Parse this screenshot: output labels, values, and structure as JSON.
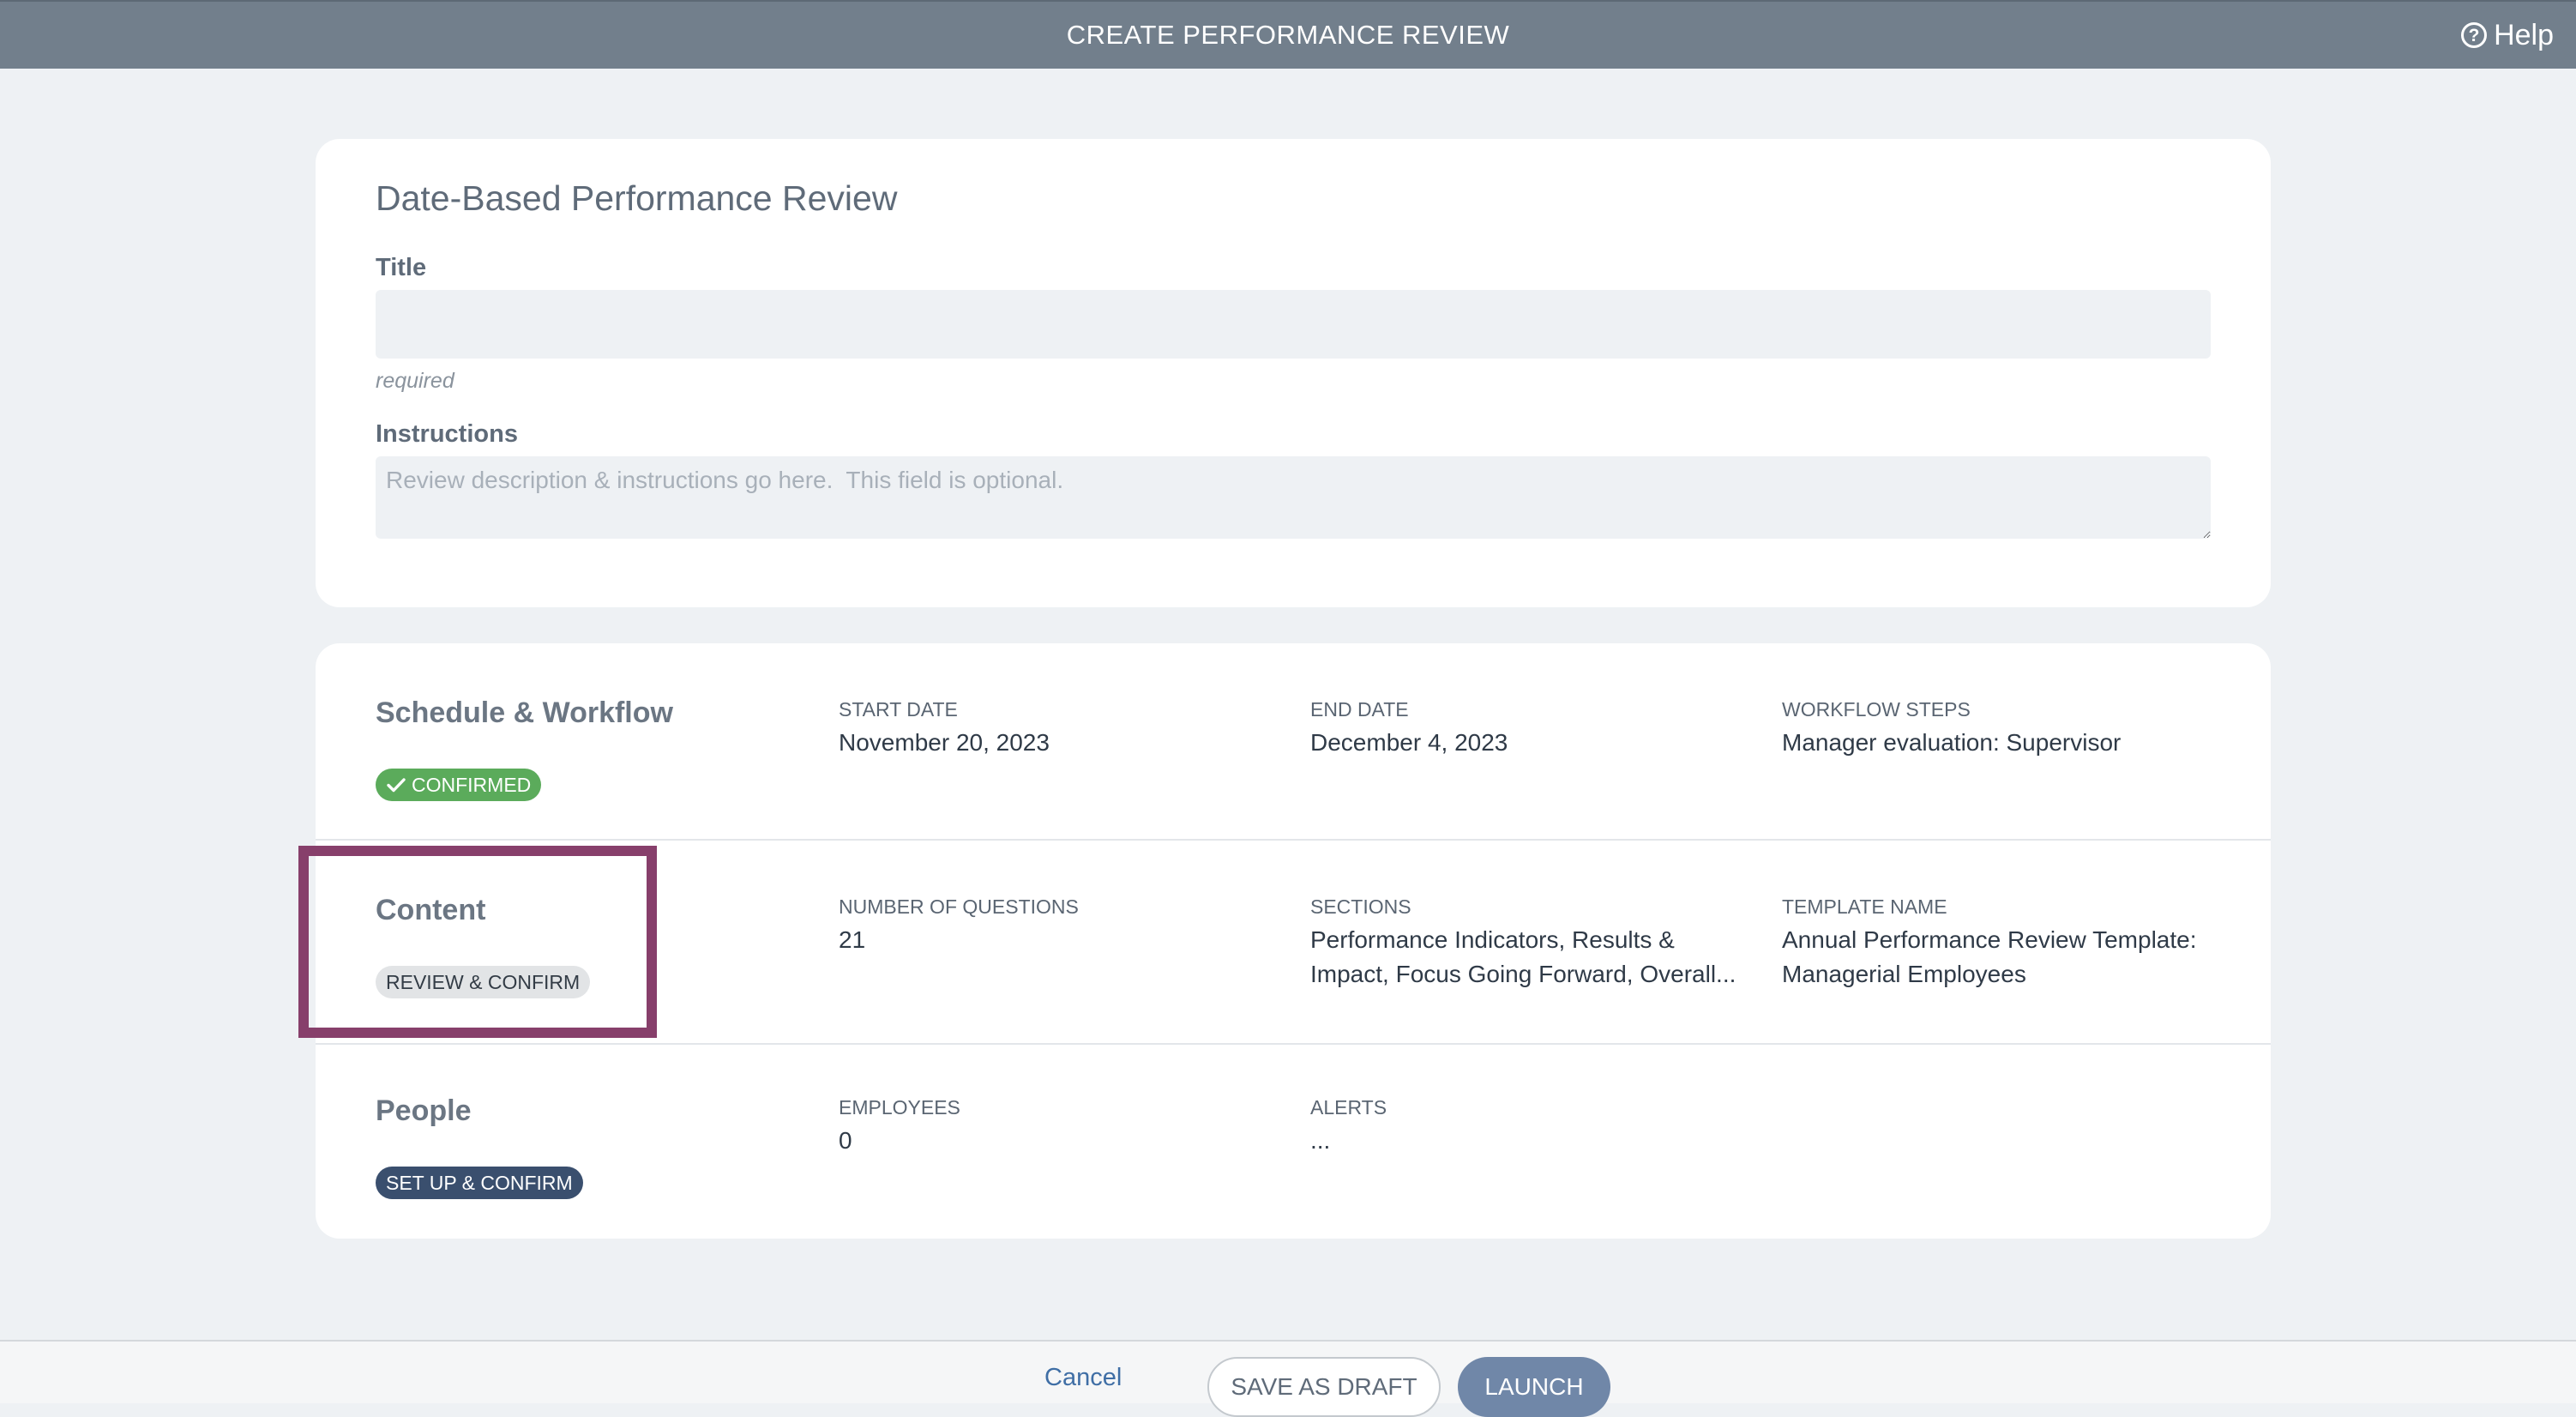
{
  "header": {
    "title": "CREATE PERFORMANCE REVIEW",
    "help_label": "Help",
    "help_icon": "question-circle-icon"
  },
  "form": {
    "heading": "Date-Based Performance Review",
    "title_label": "Title",
    "title_value": "",
    "title_hint": "required",
    "instructions_label": "Instructions",
    "instructions_placeholder": "Review description & instructions go here.  This field is optional.",
    "instructions_value": ""
  },
  "sections": {
    "schedule": {
      "title": "Schedule & Workflow",
      "status": "CONFIRMED",
      "status_icon": "checkmark-icon",
      "status_color": "#5bab5b",
      "fields": [
        {
          "label": "START DATE",
          "value": "November 20, 2023"
        },
        {
          "label": "END DATE",
          "value": "December 4, 2023"
        },
        {
          "label": "WORKFLOW STEPS",
          "value": "Manager evaluation: Supervisor"
        }
      ]
    },
    "content": {
      "title": "Content",
      "status": "REVIEW & CONFIRM",
      "fields": [
        {
          "label": "NUMBER OF QUESTIONS",
          "value": "21"
        },
        {
          "label": "SECTIONS",
          "value": "Performance Indicators, Results & Impact, Focus Going Forward, Overall..."
        },
        {
          "label": "TEMPLATE NAME",
          "value": "Annual Performance Review Template: Managerial Employees"
        }
      ]
    },
    "people": {
      "title": "People",
      "status": "SET UP & CONFIRM",
      "status_color": "#3a4f6e",
      "fields": [
        {
          "label": "EMPLOYEES",
          "value": "0"
        },
        {
          "label": "ALERTS",
          "value": "..."
        }
      ]
    }
  },
  "highlight_color": "#873f6b",
  "footer": {
    "cancel_label": "Cancel",
    "draft_label": "SAVE AS DRAFT",
    "launch_label": "LAUNCH"
  }
}
